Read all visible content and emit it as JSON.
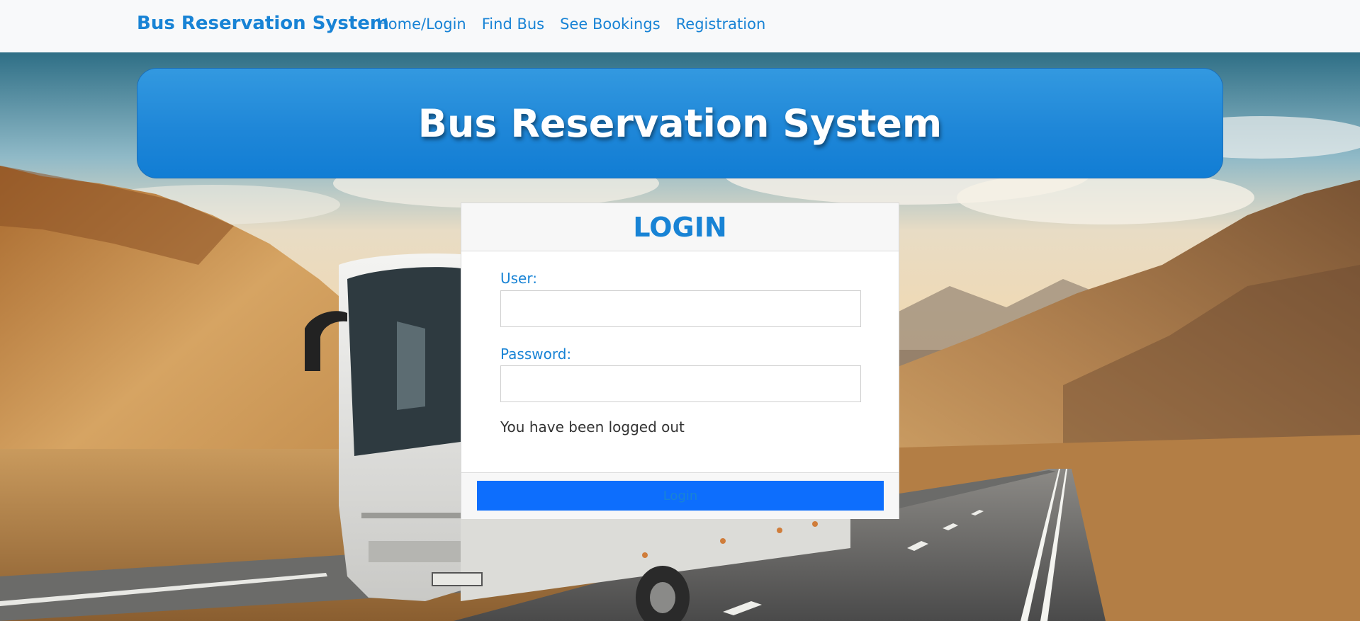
{
  "navbar": {
    "brand": "Bus Reservation System",
    "links": [
      {
        "label": "Home/Login"
      },
      {
        "label": "Find Bus"
      },
      {
        "label": "See Bookings"
      },
      {
        "label": "Registration"
      }
    ]
  },
  "banner": {
    "title": "Bus Reservation System"
  },
  "login": {
    "title": "LOGIN",
    "user_label": "User:",
    "user_value": "",
    "password_label": "Password:",
    "password_value": "",
    "message": "You have been logged out",
    "button_label": "Login"
  },
  "colors": {
    "accent": "#1883d5",
    "button": "#0d6efd",
    "banner_top": "#3399e0",
    "banner_bottom": "#117dd4"
  }
}
